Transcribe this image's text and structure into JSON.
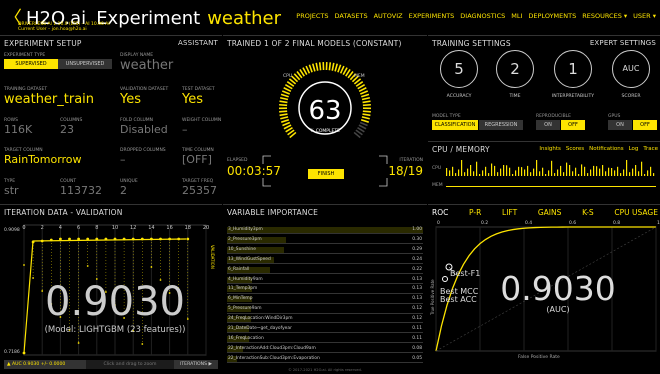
{
  "header": {
    "back": "〈",
    "brand": "H2O.ai",
    "experiment_word": "Experiment",
    "experiment_name": "weather",
    "version": "DRIVERLESS AI 1.10.0 (LTS) – AI 10.00 AI",
    "user_line": "Current User – jon.hoa@h2o.ai",
    "nav": [
      "PROJECTS",
      "DATASETS",
      "AUTOVIZ",
      "EXPERIMENTS",
      "DIAGNOSTICS",
      "MLI",
      "DEPLOYMENTS",
      "RESOURCES ▾",
      "USER ▾"
    ]
  },
  "setup": {
    "title": "EXPERIMENT SETUP",
    "assistant": "ASSISTANT",
    "exp_type_label": "EXPERIMENT TYPE",
    "supervised": "SUPERVISED",
    "unsupervised": "UNSUPERVISED",
    "display_name_label": "DISPLAY NAME",
    "display_name": "weather",
    "training_label": "TRAINING DATASET",
    "training": "weather_train",
    "validation_label": "VALIDATION DATASET",
    "validation": "Yes",
    "test_label": "TEST DATASET",
    "test": "Yes",
    "rows_label": "ROWS",
    "rows": "116K",
    "columns_label": "COLUMNS",
    "columns": "23",
    "fold_label": "FOLD COLUMN",
    "fold": "Disabled",
    "weight_label": "WEIGHT COLUMN",
    "weight": "–",
    "target_label": "TARGET COLUMN",
    "target": "RainTomorrow",
    "dropped_label": "DROPPED COLUMNS",
    "dropped": "–",
    "time_label": "TIME COLUMN",
    "time": "[OFF]",
    "type_label": "TYPE",
    "type": "str",
    "count_label": "COUNT",
    "count": "113732",
    "unique_label": "UNIQUE",
    "unique": "2",
    "freq_label": "TARGET FREQ",
    "freq": "25357"
  },
  "train": {
    "title": "TRAINED 1 OF 2 FINAL MODELS (CONSTANT)",
    "cpu": "CPU",
    "mem": "MEM",
    "pct": "63",
    "pct_label": "% COMPLETE",
    "elapsed_label": "ELAPSED",
    "elapsed": "00:03:57",
    "finish": "FINISH",
    "iter_label": "ITERATION",
    "iter": "18/19",
    "progress": 0.63
  },
  "tset": {
    "title": "TRAINING SETTINGS",
    "expert": "EXPERT SETTINGS",
    "dials": [
      {
        "v": "5",
        "l": "ACCURACY"
      },
      {
        "v": "2",
        "l": "TIME"
      },
      {
        "v": "1",
        "l": "INTERPRETABILITY"
      },
      {
        "v": "AUC",
        "l": "SCORER"
      }
    ],
    "model_type_label": "MODEL TYPE",
    "classification": "CLASSIFICATION",
    "regression": "REGRESSION",
    "repro_label": "REPRODUCIBLE",
    "on": "ON",
    "off": "OFF",
    "gpus_label": "GPUS"
  },
  "cpu": {
    "title": "CPU / MEMORY",
    "links": [
      "Insights",
      "Scores",
      "Notifications",
      "Log",
      "Trace"
    ],
    "cpu_lbl": "CPU",
    "mem_lbl": "MEM"
  },
  "iter": {
    "title": "ITERATION DATA - VALIDATION",
    "y_top": "0.9098",
    "y_bot": "0.7186",
    "x_ticks": [
      "0",
      "2",
      "4",
      "6",
      "8",
      "10",
      "12",
      "14",
      "16",
      "18",
      "20"
    ],
    "right_label": "VALIDATION",
    "score": "0.9030",
    "model": "(Model: LIGHTGBM (23 features))",
    "auc": "▲ AUC 0.9030 +/- 0.0000",
    "drag": "Click and drag to zoom",
    "iterations": "ITERATIONS ▶"
  },
  "vi": {
    "title": "VARIABLE IMPORTANCE",
    "footer": "© 2017-2021 H2O.ai. All rights reserved.",
    "rows": [
      {
        "n": "3_Humidity3pm",
        "v": "1.00"
      },
      {
        "n": "2_Pressure3pm",
        "v": "0.30"
      },
      {
        "n": "10_Sunshine",
        "v": "0.29"
      },
      {
        "n": "13_WindGustSpeed",
        "v": "0.24"
      },
      {
        "n": "6_Rainfall",
        "v": "0.22"
      },
      {
        "n": "4_Humidity9am",
        "v": "0.13"
      },
      {
        "n": "11_Temp3pm",
        "v": "0.13"
      },
      {
        "n": "6_MinTemp",
        "v": "0.13"
      },
      {
        "n": "5_Pressure9am",
        "v": "0.12"
      },
      {
        "n": "24_FreqLocation:WindDir3pm",
        "v": "0.12"
      },
      {
        "n": "21_DateDate~get_dayofyear",
        "v": "0.11"
      },
      {
        "n": "16_FreqLocation",
        "v": "0.11"
      },
      {
        "n": "22_InteractionAdd:Cloud3pm:Cloud9am",
        "v": "0.08"
      },
      {
        "n": "22_InteractionSub:Cloud3pm:Evaporation",
        "v": "0.05"
      }
    ]
  },
  "roc": {
    "tabs": [
      "ROC",
      "P-R",
      "LIFT",
      "GAINS",
      "K-S",
      "CPU USAGE"
    ],
    "x_ticks": [
      "0",
      "0.2",
      "0.4",
      "0.6",
      "0.8",
      "1"
    ],
    "best_f1": "Best-F1",
    "best_mcc": "Best MCC",
    "best_acc": "Best ACC",
    "score": "0.9030",
    "auc": "(AUC)",
    "xlabel": "False Positive Rate",
    "ylabel": "True Positive Rate"
  }
}
